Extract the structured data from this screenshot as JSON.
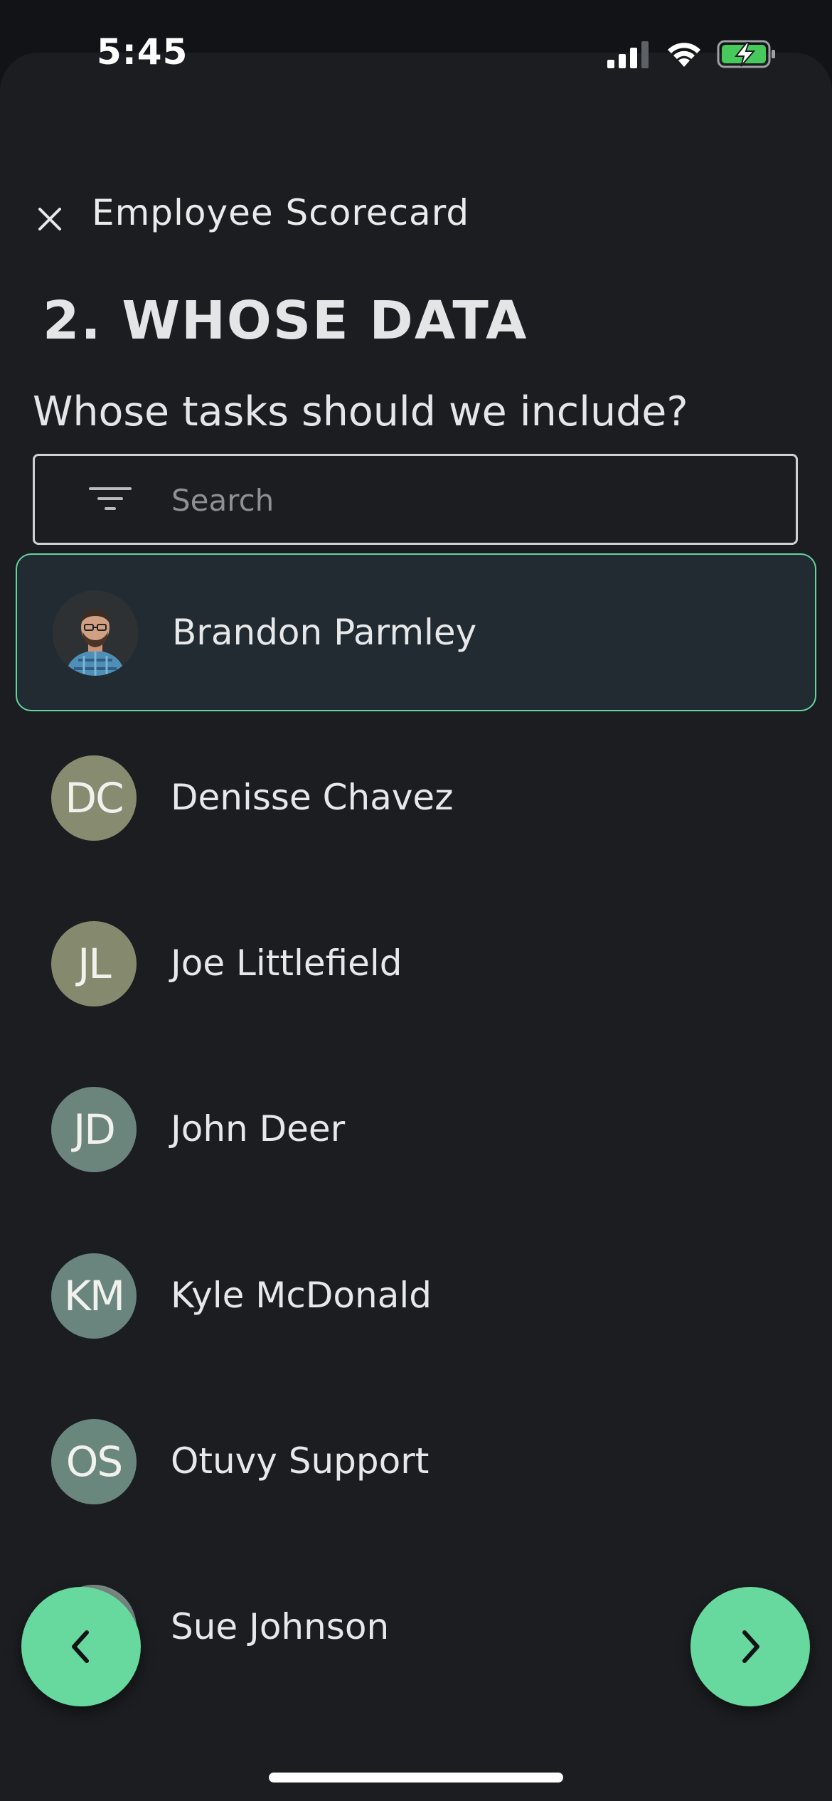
{
  "status_bar": {
    "time": "5:45",
    "icons": [
      "cellular-signal-icon",
      "wifi-icon",
      "battery-charging-icon"
    ]
  },
  "header": {
    "title": "Employee Scorecard",
    "close_icon": "close-icon"
  },
  "step": {
    "title": "2. WHOSE DATA",
    "question": "Whose tasks should we include?"
  },
  "search": {
    "placeholder": "Search",
    "value": "",
    "icon": "filter-icon"
  },
  "people": [
    {
      "name": "Brandon Parmley",
      "initials": "",
      "avatar": "photo",
      "color": "#3a3d40",
      "selected": true
    },
    {
      "name": "Denisse Chavez",
      "initials": "DC",
      "avatar": "initials",
      "color": "#878b6f",
      "selected": false
    },
    {
      "name": "Joe Littlefield",
      "initials": "JL",
      "avatar": "initials",
      "color": "#858a6f",
      "selected": false
    },
    {
      "name": "John Deer",
      "initials": "JD",
      "avatar": "initials",
      "color": "#6b857d",
      "selected": false
    },
    {
      "name": "Kyle McDonald",
      "initials": "KM",
      "avatar": "initials",
      "color": "#6a857e",
      "selected": false
    },
    {
      "name": "Otuvy Support",
      "initials": "OS",
      "avatar": "initials",
      "color": "#6a877e",
      "selected": false
    },
    {
      "name": "Sue Johnson",
      "initials": "",
      "avatar": "initials",
      "color": "#7b8a86",
      "selected": false
    }
  ],
  "navigation": {
    "back_icon": "chevron-left-icon",
    "next_icon": "chevron-right-icon"
  },
  "colors": {
    "background": "#1b1d20",
    "accent": "#67d99f",
    "selected_row": "#222b31"
  }
}
